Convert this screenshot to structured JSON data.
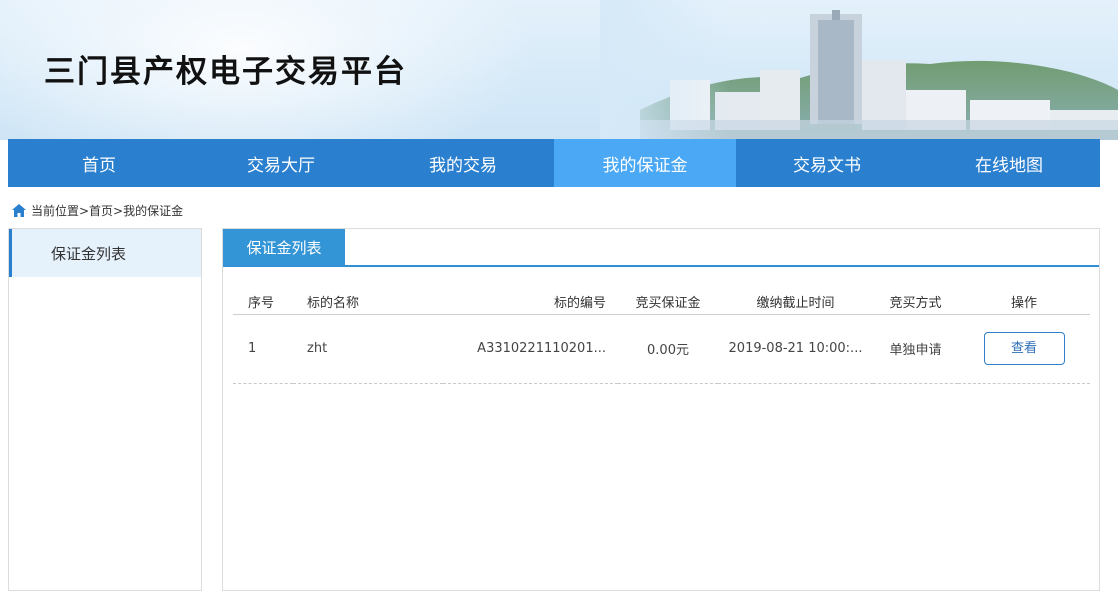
{
  "header": {
    "site_title": "三门县产权电子交易平台"
  },
  "nav": {
    "items": [
      {
        "label": "首页",
        "active": false
      },
      {
        "label": "交易大厅",
        "active": false
      },
      {
        "label": "我的交易",
        "active": false
      },
      {
        "label": "我的保证金",
        "active": true
      },
      {
        "label": "交易文书",
        "active": false
      },
      {
        "label": "在线地图",
        "active": false
      }
    ]
  },
  "breadcrumb": {
    "text": "当前位置>首页>我的保证金"
  },
  "sidebar": {
    "items": [
      {
        "label": "保证金列表",
        "active": true
      }
    ]
  },
  "panel": {
    "tab_label": "保证金列表",
    "columns": [
      "序号",
      "标的名称",
      "标的编号",
      "竞买保证金",
      "缴纳截止时间",
      "竞买方式",
      "操作"
    ],
    "rows": [
      {
        "index": "1",
        "name": "zht",
        "code": "A3310221110201...",
        "deposit": "0.00元",
        "deadline": "2019-08-21 10:00:...",
        "mode": "单独申请",
        "action": "查看"
      }
    ]
  },
  "colors": {
    "nav_bg": "#2a7fcf",
    "nav_active": "#4aa8f5",
    "tab_bg": "#3495d6",
    "button_border": "#2f7fc8"
  }
}
